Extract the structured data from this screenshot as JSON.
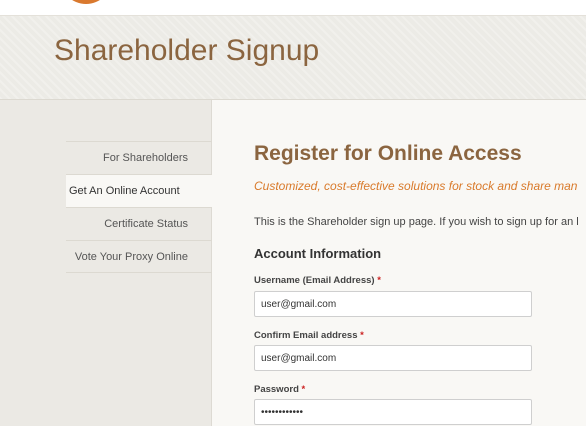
{
  "hero": {
    "title": "Shareholder Signup"
  },
  "sidebar": {
    "items": [
      {
        "label": "For Shareholders",
        "active": false
      },
      {
        "label": "Get An Online Account",
        "active": true
      },
      {
        "label": "Certificate Status",
        "active": false
      },
      {
        "label": "Vote Your Proxy Online",
        "active": false
      }
    ]
  },
  "main": {
    "heading": "Register for Online Access",
    "tagline": "Customized, cost-effective solutions for stock and share man",
    "intro": "This is the Shareholder sign up page. If you wish to sign up for an l",
    "section_title": "Account Information",
    "fields": {
      "username": {
        "label": "Username (Email Address)",
        "required": "*",
        "value": "user@gmail.com"
      },
      "confirm_email": {
        "label": "Confirm Email address",
        "required": "*",
        "value": "user@gmail.com"
      },
      "password": {
        "label": "Password",
        "required": "*",
        "value": "••••••••••••"
      }
    }
  },
  "colors": {
    "brand_brown": "#8b6540",
    "accent_orange": "#d97a2b",
    "required_red": "#cc2222"
  }
}
